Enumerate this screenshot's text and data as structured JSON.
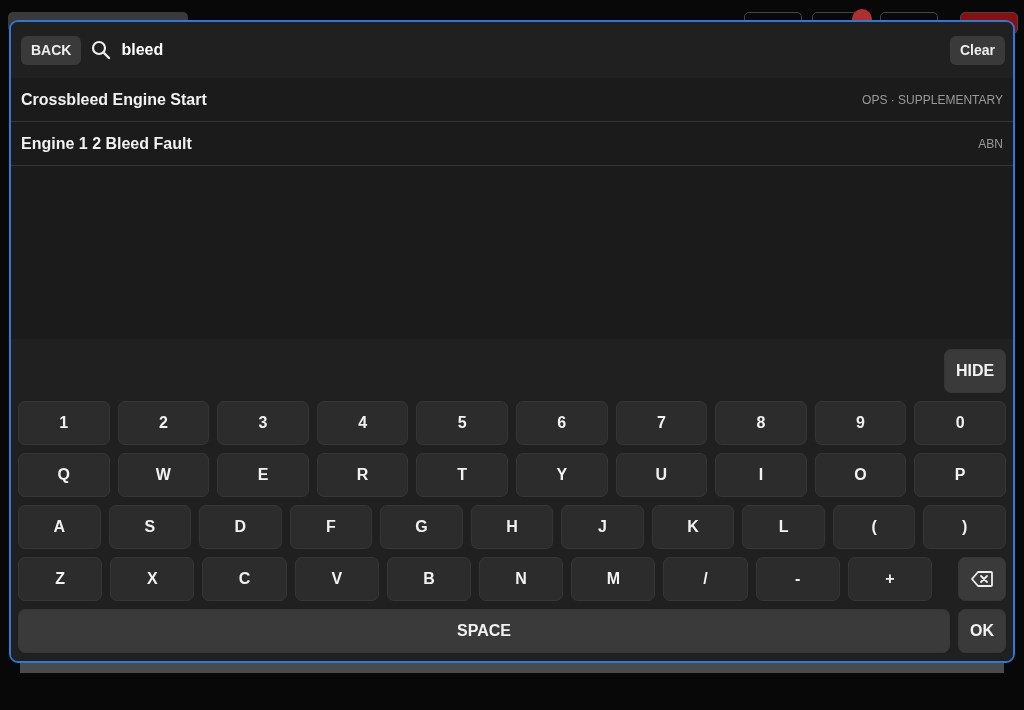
{
  "search": {
    "back_label": "BACK",
    "value": "bleed",
    "clear_label": "Clear"
  },
  "results": [
    {
      "title": "Crossbleed Engine Start",
      "category": "OPS · SUPPLEMENTARY"
    },
    {
      "title": "Engine 1 2 Bleed Fault",
      "category": "ABN"
    }
  ],
  "keyboard": {
    "hide_label": "HIDE",
    "rows": [
      [
        {
          "kind": "char",
          "label": "1"
        },
        {
          "kind": "char",
          "label": "2"
        },
        {
          "kind": "char",
          "label": "3"
        },
        {
          "kind": "char",
          "label": "4"
        },
        {
          "kind": "char",
          "label": "5"
        },
        {
          "kind": "char",
          "label": "6"
        },
        {
          "kind": "char",
          "label": "7"
        },
        {
          "kind": "char",
          "label": "8"
        },
        {
          "kind": "char",
          "label": "9"
        },
        {
          "kind": "char",
          "label": "0"
        }
      ],
      [
        {
          "kind": "char",
          "label": "Q"
        },
        {
          "kind": "char",
          "label": "W"
        },
        {
          "kind": "char",
          "label": "E"
        },
        {
          "kind": "char",
          "label": "R"
        },
        {
          "kind": "char",
          "label": "T"
        },
        {
          "kind": "char",
          "label": "Y"
        },
        {
          "kind": "char",
          "label": "U"
        },
        {
          "kind": "char",
          "label": "I"
        },
        {
          "kind": "char",
          "label": "O"
        },
        {
          "kind": "char",
          "label": "P"
        }
      ],
      [
        {
          "kind": "char",
          "label": "A"
        },
        {
          "kind": "char",
          "label": "S"
        },
        {
          "kind": "char",
          "label": "D"
        },
        {
          "kind": "char",
          "label": "F"
        },
        {
          "kind": "char",
          "label": "G"
        },
        {
          "kind": "char",
          "label": "H"
        },
        {
          "kind": "char",
          "label": "J"
        },
        {
          "kind": "char",
          "label": "K"
        },
        {
          "kind": "char",
          "label": "L"
        },
        {
          "kind": "char",
          "label": "("
        },
        {
          "kind": "char",
          "label": ")"
        }
      ],
      [
        {
          "kind": "char",
          "label": "Z"
        },
        {
          "kind": "char",
          "label": "X"
        },
        {
          "kind": "char",
          "label": "C"
        },
        {
          "kind": "char",
          "label": "V"
        },
        {
          "kind": "char",
          "label": "B"
        },
        {
          "kind": "char",
          "label": "N"
        },
        {
          "kind": "char",
          "label": "M"
        },
        {
          "kind": "char",
          "label": "/"
        },
        {
          "kind": "char",
          "label": "-"
        },
        {
          "kind": "char",
          "label": "+"
        },
        {
          "kind": "backspace"
        }
      ]
    ],
    "space_label": "SPACE",
    "ok_label": "OK"
  }
}
